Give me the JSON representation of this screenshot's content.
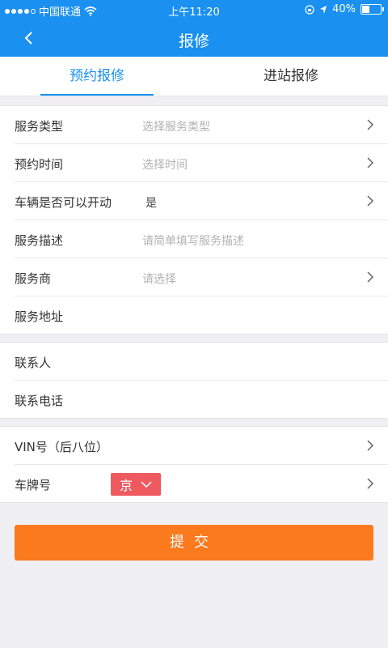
{
  "status_bar": {
    "carrier": "中国联通",
    "time": "上午11:20",
    "battery": "40%",
    "battery_level": 0.4
  },
  "navbar": {
    "title": "报修"
  },
  "tabs": [
    {
      "label": "预约报修",
      "active": true
    },
    {
      "label": "进站报修",
      "active": false
    }
  ],
  "form": {
    "service_type": {
      "label": "服务类型",
      "placeholder": "选择服务类型"
    },
    "appointment_time": {
      "label": "预约时间",
      "placeholder": "选择时间"
    },
    "vehicle_startable": {
      "label": "车辆是否可以开动",
      "value": "是"
    },
    "service_description": {
      "label": "服务描述",
      "placeholder": "请简单填写服务描述"
    },
    "service_provider": {
      "label": "服务商",
      "placeholder": "请选择"
    },
    "service_address": {
      "label": "服务地址"
    },
    "contact_person": {
      "label": "联系人"
    },
    "contact_phone": {
      "label": "联系电话"
    },
    "vin": {
      "label": "VIN号（后八位）"
    },
    "plate_number": {
      "label": "车牌号",
      "province": "京"
    }
  },
  "submit_label": "提交",
  "colors": {
    "primary": "#1a90f0",
    "submit": "#fb7a1e",
    "plate_badge": "#ee5a5f"
  }
}
